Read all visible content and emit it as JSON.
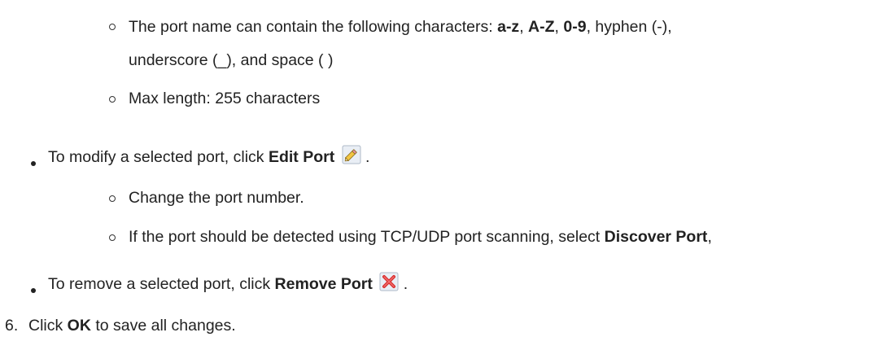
{
  "content": {
    "portname_chars": {
      "prefix": "The port name can contain the following characters: ",
      "az": "a-z",
      "sep1": ", ",
      "AZ": "A-Z",
      "sep2": ", ",
      "digits": "0-9",
      "suffix": ", hyphen (-),",
      "line2": "underscore (_), and space ( )"
    },
    "maxlength": "Max length: 255 characters",
    "modify": {
      "prefix": "To modify a selected port, click ",
      "bold": "Edit Port",
      "suffix": ".",
      "icon": "pencil-icon"
    },
    "change_number": "Change the port number.",
    "discover": {
      "prefix": "If the port should be detected using TCP/UDP port scanning, select ",
      "bold": "Discover Port",
      "suffix": ","
    },
    "remove": {
      "prefix": "To remove a selected port, click ",
      "bold": "Remove Port",
      "suffix": ".",
      "icon": "red-x-icon"
    },
    "step6": {
      "number": "6.",
      "prefix": "Click ",
      "bold": "OK",
      "suffix": " to save all changes."
    }
  }
}
